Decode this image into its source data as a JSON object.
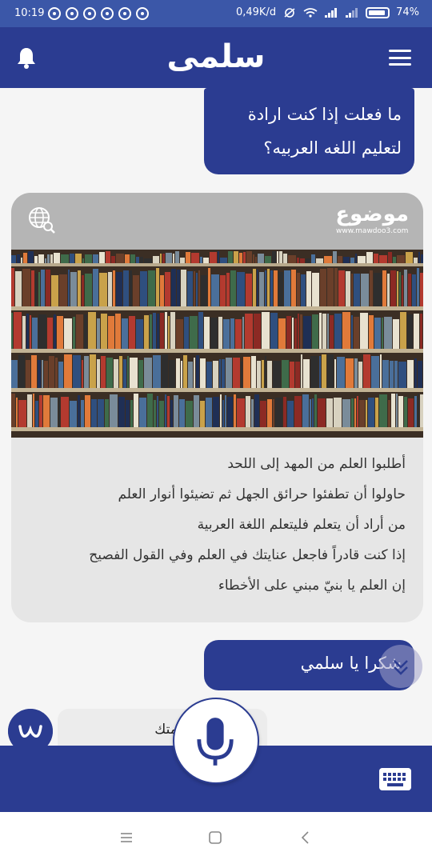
{
  "status_bar": {
    "time": "10:19",
    "network_speed": "0,49K/d",
    "battery": "74%"
  },
  "header": {
    "app_name": "سلمى"
  },
  "messages": {
    "user_1_line1": "ما فعلت إذا كنت ارادة",
    "user_1_line2": "لتعليم اللغه العربيه؟",
    "user_2": "شكرا يا سلمي",
    "bot_reply": "ي خدمتك"
  },
  "card": {
    "source_name": "موضوع",
    "source_url": "www.mawdoo3.com",
    "lines": [
      "أطلبوا العلم من المهد إلى اللحد",
      "حاولوا أن تطفئوا حرائق الجهل ثم تضيئوا أنوار العلم",
      "من أراد أن يتعلم فليتعلم اللغة العربية",
      "إذا كنت قادراً فاجعل عنايتك في العلم وفي القول الفصيح",
      "إن العلم يا بنيّ مبني على الأخطاء"
    ]
  },
  "colors": {
    "primary": "#2b3c91",
    "status_bar": "#3b57a8",
    "card_bg": "#e6e6e6"
  }
}
